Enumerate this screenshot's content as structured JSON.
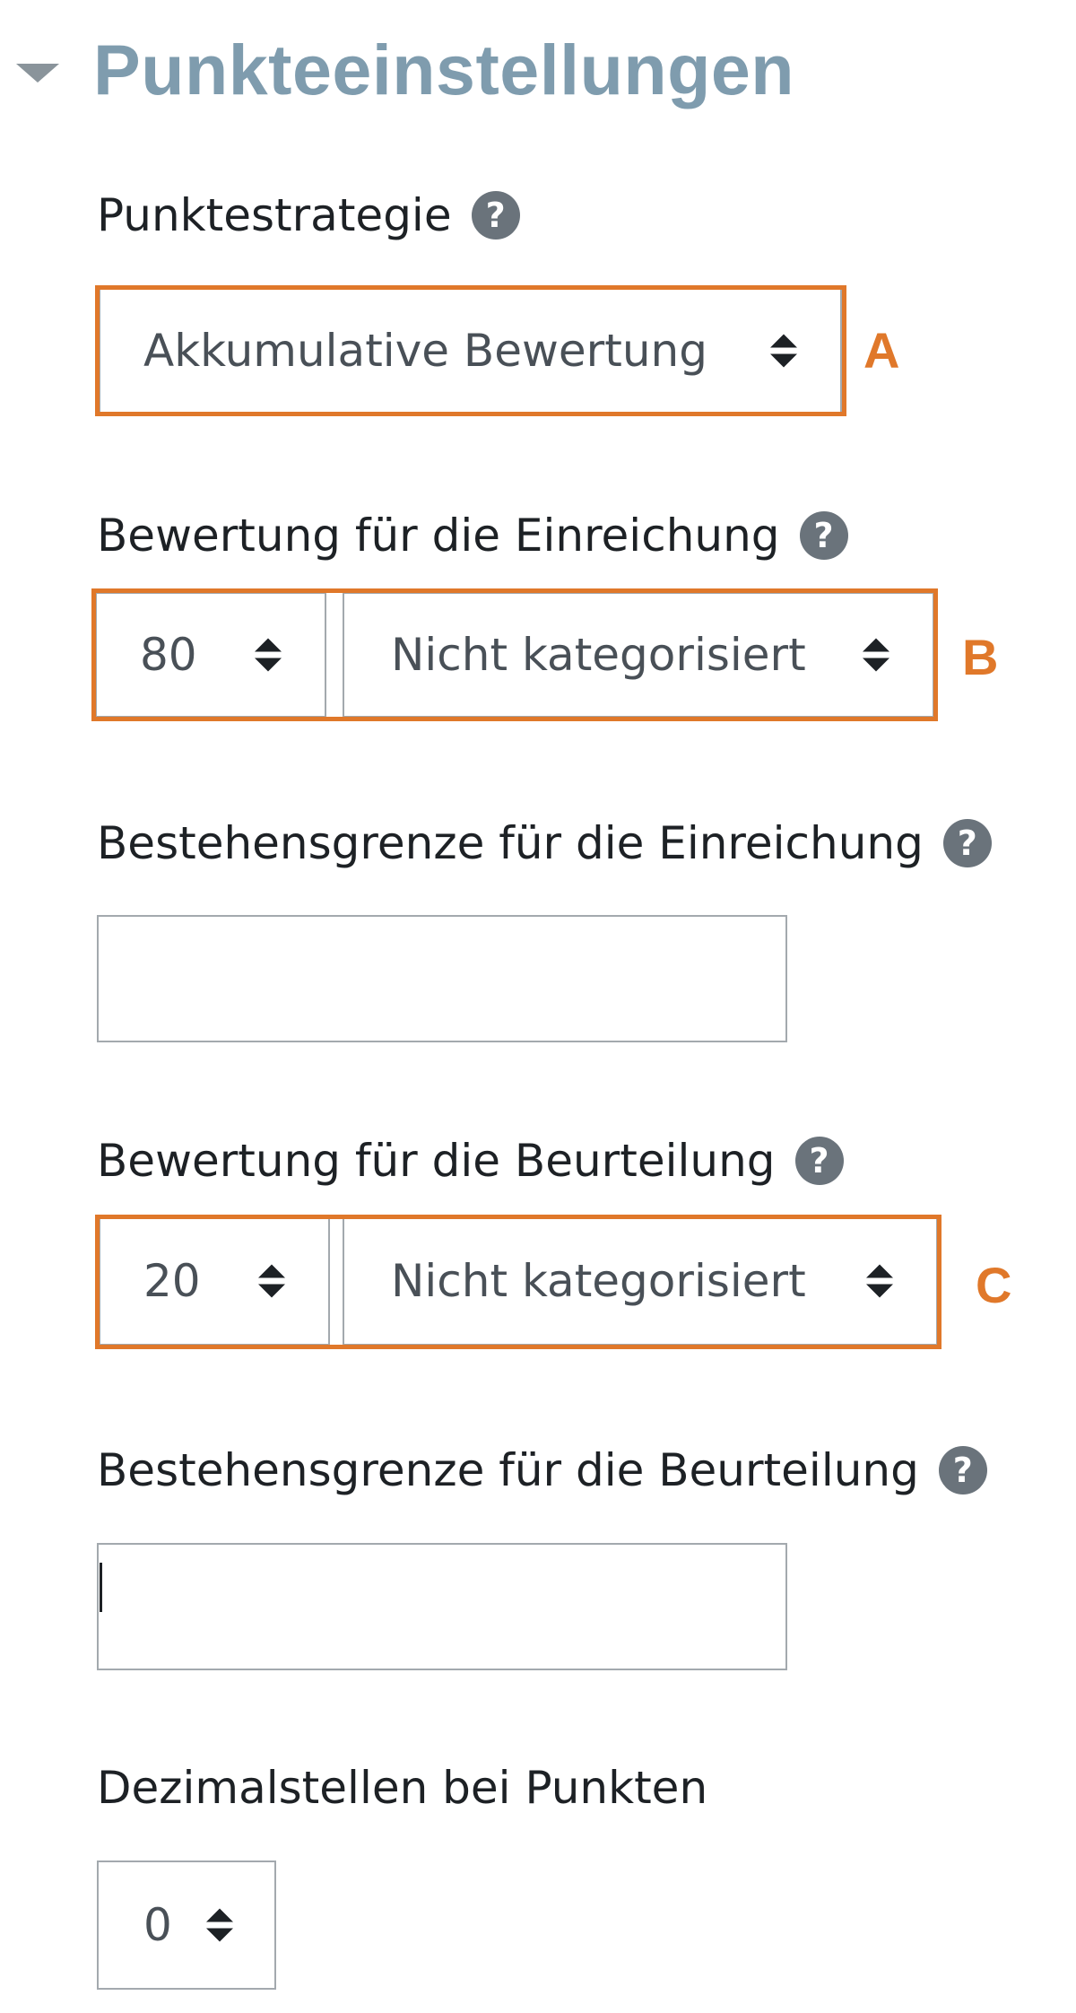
{
  "section": {
    "title": "Punkteeinstellungen"
  },
  "grading_strategy": {
    "label": "Punktestrategie",
    "selected": "Akkumulative Bewertung",
    "marker": "A"
  },
  "submission_grade": {
    "label": "Bewertung für die Einreichung",
    "points_selected": "80",
    "category_selected": "Nicht kategorisiert",
    "marker": "B"
  },
  "submission_pass": {
    "label": "Bestehensgrenze für die Einreichung",
    "value": ""
  },
  "assessment_grade": {
    "label": "Bewertung für die Beurteilung",
    "points_selected": "20",
    "category_selected": "Nicht kategorisiert",
    "marker": "C"
  },
  "assessment_pass": {
    "label": "Bestehensgrenze für die Beurteilung",
    "value": ""
  },
  "decimals": {
    "label": "Dezimalstellen bei Punkten",
    "selected": "0"
  },
  "colors": {
    "section_title": "#7f9cae",
    "highlight": "#e0782a",
    "help_icon": "#6a737b",
    "input_border": "#a3a9ae"
  },
  "icons": {
    "help": "question-circle-icon",
    "collapse": "caret-down-icon",
    "select_arrows": "sort-arrows-icon"
  }
}
